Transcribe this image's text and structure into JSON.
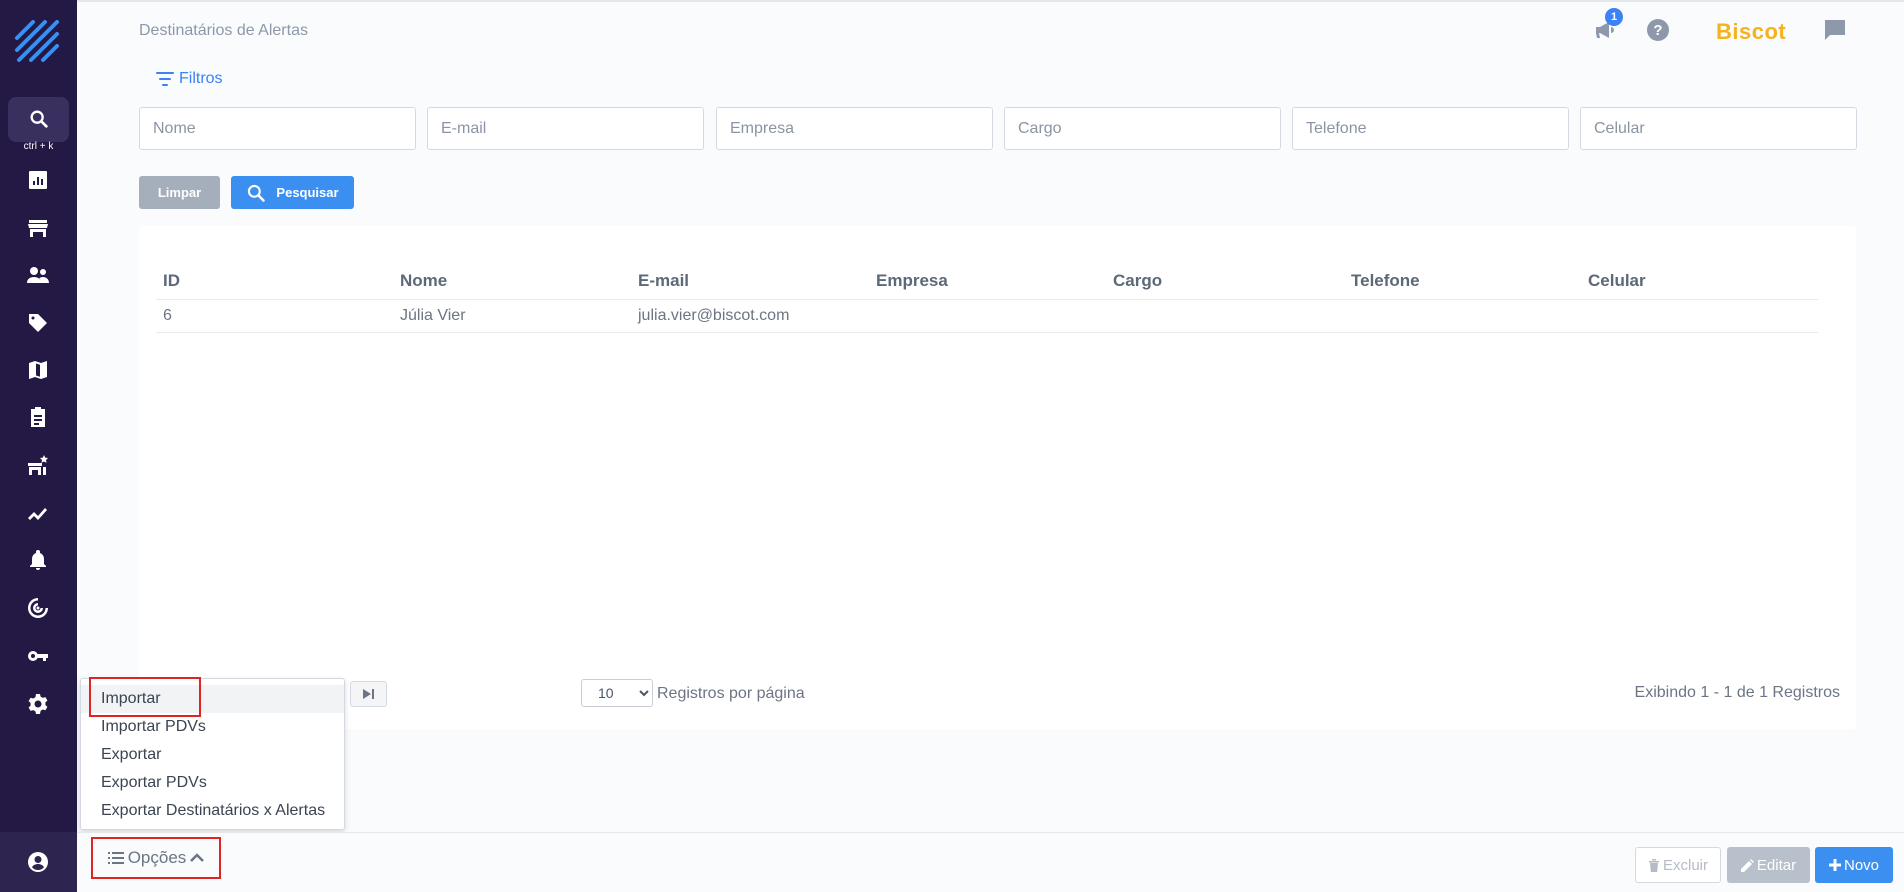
{
  "sidebar": {
    "search_shortcut": "ctrl + k",
    "items": [
      {
        "icon": "dashboard-chart-icon"
      },
      {
        "icon": "store-icon"
      },
      {
        "icon": "users-icon"
      },
      {
        "icon": "tag-icon"
      },
      {
        "icon": "map-icon"
      },
      {
        "icon": "clipboard-icon"
      },
      {
        "icon": "store-star-icon"
      },
      {
        "icon": "trend-line-icon"
      },
      {
        "icon": "bell-icon"
      },
      {
        "icon": "radar-icon"
      },
      {
        "icon": "key-icon"
      },
      {
        "icon": "settings-icon"
      }
    ],
    "profile_icon": "account-icon"
  },
  "header": {
    "title": "Destinatários de Alertas",
    "notification_count": "1",
    "brand": "Biscot"
  },
  "filters": {
    "toggle_label": "Filtros",
    "fields": [
      {
        "placeholder": "Nome",
        "value": ""
      },
      {
        "placeholder": "E-mail",
        "value": ""
      },
      {
        "placeholder": "Empresa",
        "value": ""
      },
      {
        "placeholder": "Cargo",
        "value": ""
      },
      {
        "placeholder": "Telefone",
        "value": ""
      },
      {
        "placeholder": "Celular",
        "value": ""
      }
    ],
    "clear_label": "Limpar",
    "search_label": "Pesquisar"
  },
  "table": {
    "columns": [
      "ID",
      "Nome",
      "E-mail",
      "Empresa",
      "Cargo",
      "Telefone",
      "Celular"
    ],
    "rows": [
      [
        "6",
        "Júlia Vier",
        "julia.vier@biscot.com",
        "",
        "",
        "",
        ""
      ]
    ]
  },
  "pagination": {
    "per_page": "10",
    "per_page_label": "Registros por página",
    "info": "Exibindo 1 - 1 de 1 Registros"
  },
  "options_menu": {
    "label": "Opções",
    "items": [
      "Importar",
      "Importar PDVs",
      "Exportar",
      "Exportar PDVs",
      "Exportar Destinatários x Alertas"
    ]
  },
  "actions": {
    "delete_label": "Excluir",
    "edit_label": "Editar",
    "new_label": "Novo"
  },
  "colors": {
    "sidebar": "#231944",
    "accent": "#3b8ff0",
    "brand": "#f6b21b",
    "highlight": "#e02424"
  }
}
